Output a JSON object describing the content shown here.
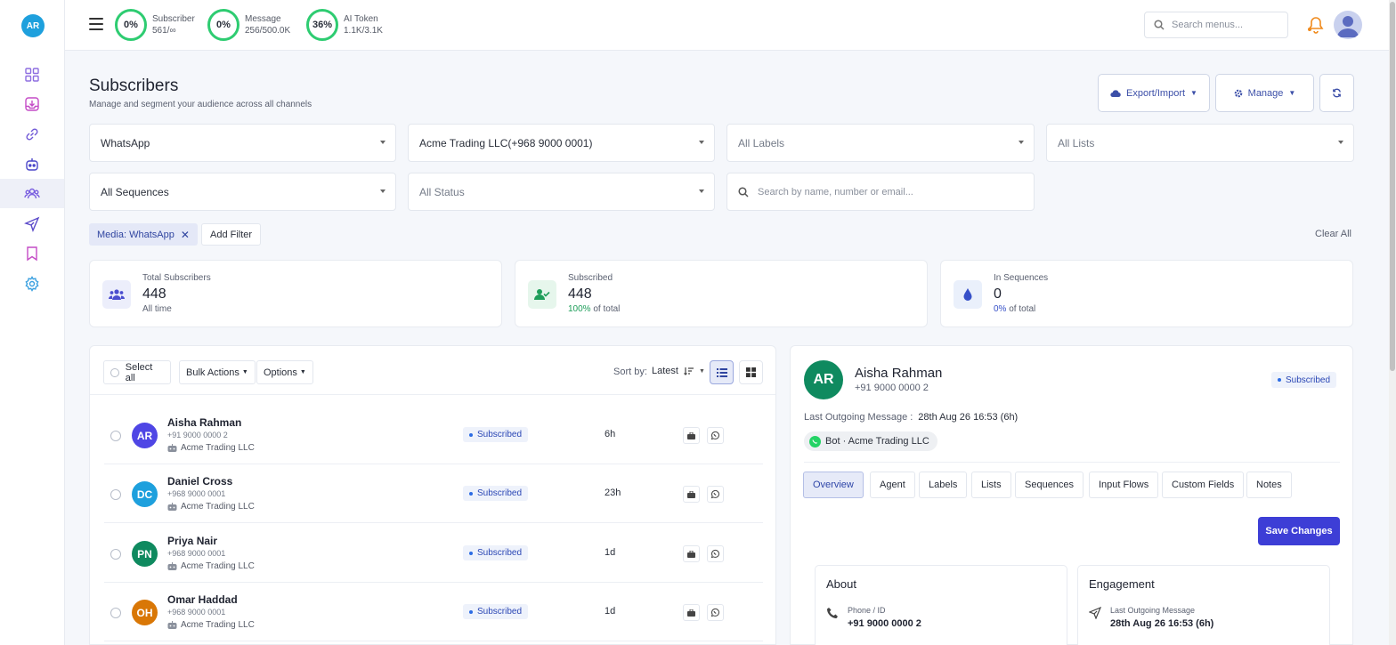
{
  "sidebar": {
    "logo": "AR",
    "items": [
      {
        "name": "dashboard",
        "color": "#8e6ee0"
      },
      {
        "name": "inbox",
        "color": "#c44bc6"
      },
      {
        "name": "integrations",
        "color": "#6f58d6"
      },
      {
        "name": "bot",
        "color": "#4a45c9"
      },
      {
        "name": "subscribers",
        "color": "#7a5fe0",
        "active": true
      },
      {
        "name": "broadcast",
        "color": "#5a49c9"
      },
      {
        "name": "bookmarks",
        "color": "#c44bc6"
      },
      {
        "name": "settings",
        "color": "#3aa0e0"
      }
    ]
  },
  "topbar": {
    "quotas": [
      {
        "pct": "0%",
        "label": "Subscriber",
        "value": "561/∞"
      },
      {
        "pct": "0%",
        "label": "Message",
        "value": "256/500.0K"
      },
      {
        "pct": "36%",
        "label": "AI Token",
        "value": "1.1K/3.1K"
      }
    ],
    "search_placeholder": "Search menus..."
  },
  "page": {
    "title": "Subscribers",
    "subtitle": "Manage and segment your audience across all channels",
    "export_label": "Export/Import",
    "manage_label": "Manage"
  },
  "filters": {
    "channel": "WhatsApp",
    "account": "Acme Trading LLC(+968 9000 0001)",
    "labels": "All Labels",
    "lists": "All Lists",
    "sequences": "All Sequences",
    "status": "All Status",
    "search_placeholder": "Search by name, number or email...",
    "chip": "Media: WhatsApp",
    "add_filter": "Add Filter",
    "clear_all": "Clear All"
  },
  "stats": [
    {
      "label": "Total Subscribers",
      "value": "448",
      "sub_pct": "",
      "sub": "All time",
      "color": "#4b4ecf",
      "bg": "#eceefb"
    },
    {
      "label": "Subscribed",
      "value": "448",
      "sub_pct": "100%",
      "sub": " of total",
      "color": "#1e9e5a",
      "bg": "#e6f6ec"
    },
    {
      "label": "In Sequences",
      "value": "0",
      "sub_pct": "0%",
      "sub": " of total",
      "color": "#3650c8",
      "bg": "#eaf0fb"
    }
  ],
  "list": {
    "select_all": "Select all",
    "bulk_actions": "Bulk Actions",
    "options": "Options",
    "sort_label": "Sort by:",
    "sort_value": "Latest",
    "rows": [
      {
        "initials": "AR",
        "name": "Aisha Rahman",
        "phone": "+91 9000 0000 2",
        "company": "Acme Trading LLC",
        "status": "Subscribed",
        "time": "6h",
        "color": "#4f46e5"
      },
      {
        "initials": "DC",
        "name": "Daniel Cross",
        "phone": "+968 9000 0001",
        "company": "Acme Trading LLC",
        "status": "Subscribed",
        "time": "23h",
        "color": "#1ea0dd"
      },
      {
        "initials": "PN",
        "name": "Priya Nair",
        "phone": "+968 9000 0001",
        "company": "Acme Trading LLC",
        "status": "Subscribed",
        "time": "1d",
        "color": "#0f8a5f"
      },
      {
        "initials": "OH",
        "name": "Omar Haddad",
        "phone": "+968 9000 0001",
        "company": "Acme Trading LLC",
        "status": "Subscribed",
        "time": "1d",
        "color": "#d97706"
      }
    ]
  },
  "detail": {
    "initials": "AR",
    "name": "Aisha Rahman",
    "phone": "+91 9000 0000 2",
    "status": "Subscribed",
    "last_outgoing_label": "Last Outgoing Message :",
    "last_outgoing_value": "28th Aug 26 16:53 (6h)",
    "bot": "Bot · Acme Trading LLC",
    "tabs": [
      "Overview",
      "Agent",
      "Labels",
      "Lists",
      "Sequences",
      "Input Flows",
      "Custom Fields",
      "Notes"
    ],
    "save_label": "Save Changes",
    "about": {
      "title": "About",
      "field_label": "Phone / ID",
      "field_value": "+91 9000 0000 2"
    },
    "engagement": {
      "title": "Engagement",
      "field_label": "Last Outgoing Message",
      "field_value": "28th Aug 26 16:53 (6h)"
    }
  }
}
